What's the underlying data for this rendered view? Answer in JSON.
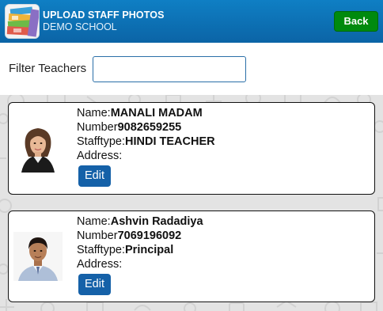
{
  "header": {
    "title": "UPLOAD STAFF PHOTOS",
    "subtitle": "DEMO SCHOOL",
    "back_label": "Back",
    "logo_icon": "stacked-photos-icon",
    "colors": {
      "bar": "#0b6fb3",
      "back": "#008a0e",
      "edit": "#1561a8"
    }
  },
  "filter": {
    "label": "Filter Teachers",
    "value": "",
    "placeholder": ""
  },
  "staff": [
    {
      "name_label": "Name:",
      "name": "MANALI MADAM",
      "number_label": "Number",
      "number": "9082659255",
      "type_label": "Stafftype:",
      "type": "HINDI TEACHER",
      "address_label": "Address:",
      "address": "",
      "edit_label": "Edit",
      "photo_icon": "female-staff-photo"
    },
    {
      "name_label": "Name:",
      "name": "Ashvin Radadiya",
      "number_label": "Number",
      "number": "7069196092",
      "type_label": "Stafftype:",
      "type": "Principal",
      "address_label": "Address:",
      "address": "",
      "edit_label": "Edit",
      "photo_icon": "male-staff-photo"
    }
  ]
}
